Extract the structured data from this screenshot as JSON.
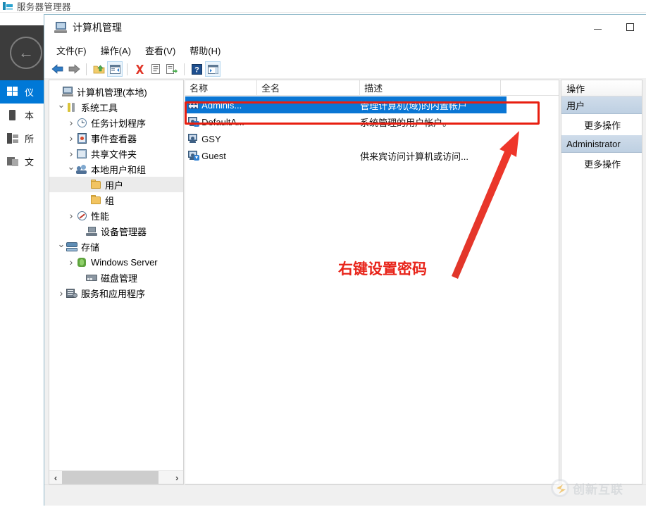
{
  "server_manager": {
    "title": "服务器管理器",
    "title_icon": "server-manager-icon",
    "back_icon": "back-arrow-icon",
    "nav": [
      {
        "label": "仪",
        "icon": "dashboard-icon",
        "active": true
      },
      {
        "label": "本",
        "icon": "local-server-icon",
        "active": false
      },
      {
        "label": "所",
        "icon": "all-servers-icon",
        "active": false
      },
      {
        "label": "文",
        "icon": "file-storage-services-icon",
        "active": false
      }
    ]
  },
  "computer_management": {
    "title": "计算机管理",
    "title_icon": "computer-management-icon",
    "window_buttons": {
      "minimize": "minimize-icon",
      "maximize": "maximize-icon"
    },
    "menus": [
      {
        "label": "文件(F)"
      },
      {
        "label": "操作(A)"
      },
      {
        "label": "查看(V)"
      },
      {
        "label": "帮助(H)"
      }
    ],
    "toolbar": [
      {
        "icon": "back-arrow-icon",
        "framed": false
      },
      {
        "icon": "forward-arrow-icon",
        "framed": false
      },
      {
        "sep": true
      },
      {
        "icon": "up-folder-icon",
        "framed": false
      },
      {
        "icon": "show-hide-tree-icon",
        "framed": true
      },
      {
        "sep": true
      },
      {
        "icon": "delete-x-icon",
        "framed": false
      },
      {
        "icon": "properties-icon",
        "framed": false
      },
      {
        "icon": "export-list-icon",
        "framed": false
      },
      {
        "sep": true
      },
      {
        "icon": "help-question-icon",
        "framed": false
      },
      {
        "icon": "show-action-pane-icon",
        "framed": true
      }
    ],
    "tree": [
      {
        "label": "计算机管理(本地)",
        "icon": "computer-icon",
        "indent": 0,
        "twisty": "none",
        "selected": false
      },
      {
        "label": "系统工具",
        "icon": "system-tools-icon",
        "indent": 1,
        "twisty": "open",
        "selected": false
      },
      {
        "label": "任务计划程序",
        "icon": "task-scheduler-icon",
        "indent": 2,
        "twisty": "closed",
        "selected": false
      },
      {
        "label": "事件查看器",
        "icon": "event-viewer-icon",
        "indent": 2,
        "twisty": "closed",
        "selected": false
      },
      {
        "label": "共享文件夹",
        "icon": "shared-folders-icon",
        "indent": 2,
        "twisty": "closed",
        "selected": false
      },
      {
        "label": "本地用户和组",
        "icon": "local-users-groups-icon",
        "indent": 2,
        "twisty": "open",
        "selected": false
      },
      {
        "label": "用户",
        "icon": "folder-icon",
        "indent": 3,
        "twisty": "none",
        "selected": true
      },
      {
        "label": "组",
        "icon": "folder-icon",
        "indent": 3,
        "twisty": "none",
        "selected": false
      },
      {
        "label": "性能",
        "icon": "performance-icon",
        "indent": 2,
        "twisty": "closed",
        "selected": false
      },
      {
        "label": "设备管理器",
        "icon": "device-manager-icon",
        "indent": 2,
        "twisty": "none",
        "selected": false
      },
      {
        "label": "存储",
        "icon": "storage-icon",
        "indent": 1,
        "twisty": "open",
        "selected": false
      },
      {
        "label": "Windows Server ",
        "icon": "windows-server-backup-icon",
        "indent": 2,
        "twisty": "closed",
        "selected": false
      },
      {
        "label": "磁盘管理",
        "icon": "disk-management-icon",
        "indent": 2,
        "twisty": "none",
        "selected": false
      },
      {
        "label": "服务和应用程序",
        "icon": "services-applications-icon",
        "indent": 1,
        "twisty": "closed",
        "selected": false
      }
    ],
    "tree_scrollbar": {
      "left_arrow": "chevron-left-icon",
      "right_arrow": "chevron-right-icon"
    },
    "list": {
      "columns": [
        {
          "label": "名称"
        },
        {
          "label": "全名"
        },
        {
          "label": "描述"
        },
        {
          "label": ""
        }
      ],
      "rows": [
        {
          "name": "Adminis...",
          "full_name": "",
          "description": "管理计算机(域)的内置帐户",
          "icon": "administrator-user-icon",
          "selected": true
        },
        {
          "name": "DefaultA...",
          "full_name": "",
          "description": "系统管理的用户帐户。",
          "icon": "disabled-user-icon",
          "selected": false
        },
        {
          "name": "GSY",
          "full_name": "",
          "description": "",
          "icon": "user-icon",
          "selected": false
        },
        {
          "name": "Guest",
          "full_name": "",
          "description": "供来宾访问计算机或访问...",
          "icon": "disabled-user-icon",
          "selected": false
        }
      ]
    },
    "actions": {
      "header": "操作",
      "sections": [
        {
          "title": "用户",
          "items": [
            {
              "label": "更多操作"
            }
          ]
        },
        {
          "title": "Administrator",
          "items": [
            {
              "label": "更多操作"
            }
          ]
        }
      ]
    }
  },
  "annotations": {
    "highlight_box_label": "selected-row-highlight",
    "arrow_label": "pointer-arrow",
    "note_text": "右键设置密码",
    "color": "#e8241a"
  },
  "watermark": {
    "text": "创新互联",
    "logo_icon": "chuangxin-hulian-logo"
  }
}
